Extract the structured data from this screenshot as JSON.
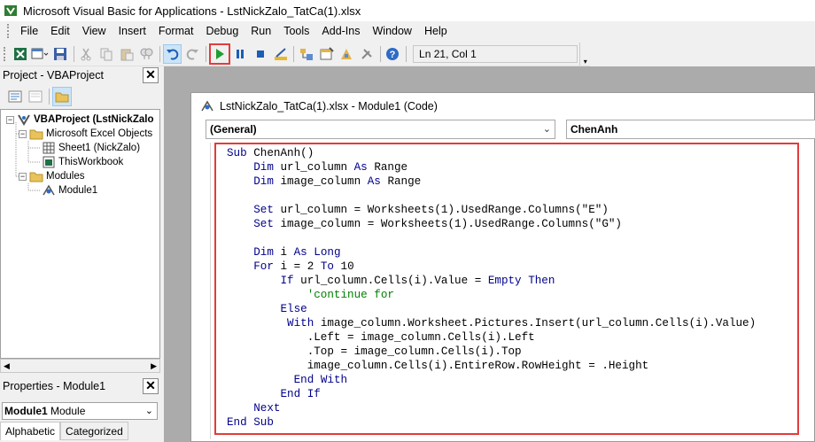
{
  "window": {
    "title": "Microsoft Visual Basic for Applications - LstNickZalo_TatCa(1).xlsx"
  },
  "menu": [
    "File",
    "Edit",
    "View",
    "Insert",
    "Format",
    "Debug",
    "Run",
    "Tools",
    "Add-Ins",
    "Window",
    "Help"
  ],
  "toolbar": {
    "cursor_position": "Ln 21, Col 1"
  },
  "project_panel": {
    "title": "Project - VBAProject",
    "tree": {
      "root": "VBAProject (LstNickZalo",
      "excel_objects_folder": "Microsoft Excel Objects",
      "sheet1": "Sheet1 (NickZalo)",
      "thisworkbook": "ThisWorkbook",
      "modules_folder": "Modules",
      "module1": "Module1"
    }
  },
  "properties_panel": {
    "title": "Properties - Module1",
    "selected_object": "Module1",
    "selected_type": "Module",
    "tabs": [
      "Alphabetic",
      "Categorized"
    ]
  },
  "code_window": {
    "title": "LstNickZalo_TatCa(1).xlsx - Module1 (Code)",
    "object_combo": "(General)",
    "procedure_combo": "ChenAnh",
    "lines": [
      "Sub ChenAnh()",
      "    Dim url_column As Range",
      "    Dim image_column As Range",
      "",
      "    Set url_column = Worksheets(1).UsedRange.Columns(\"E\")",
      "    Set image_column = Worksheets(1).UsedRange.Columns(\"G\")",
      "",
      "    Dim i As Long",
      "    For i = 2 To 10",
      "        If url_column.Cells(i).Value = Empty Then",
      "            'continue for",
      "        Else",
      "         With image_column.Worksheet.Pictures.Insert(url_column.Cells(i).Value)",
      "            .Left = image_column.Cells(i).Left",
      "            .Top = image_column.Cells(i).Top",
      "            image_column.Cells(i).EntireRow.RowHeight = .Height",
      "          End With",
      "        End If",
      "    Next",
      "End Sub"
    ]
  },
  "colors": {
    "keyword": "#00008b",
    "comment": "#008000",
    "highlight_border": "#e33b3b"
  }
}
